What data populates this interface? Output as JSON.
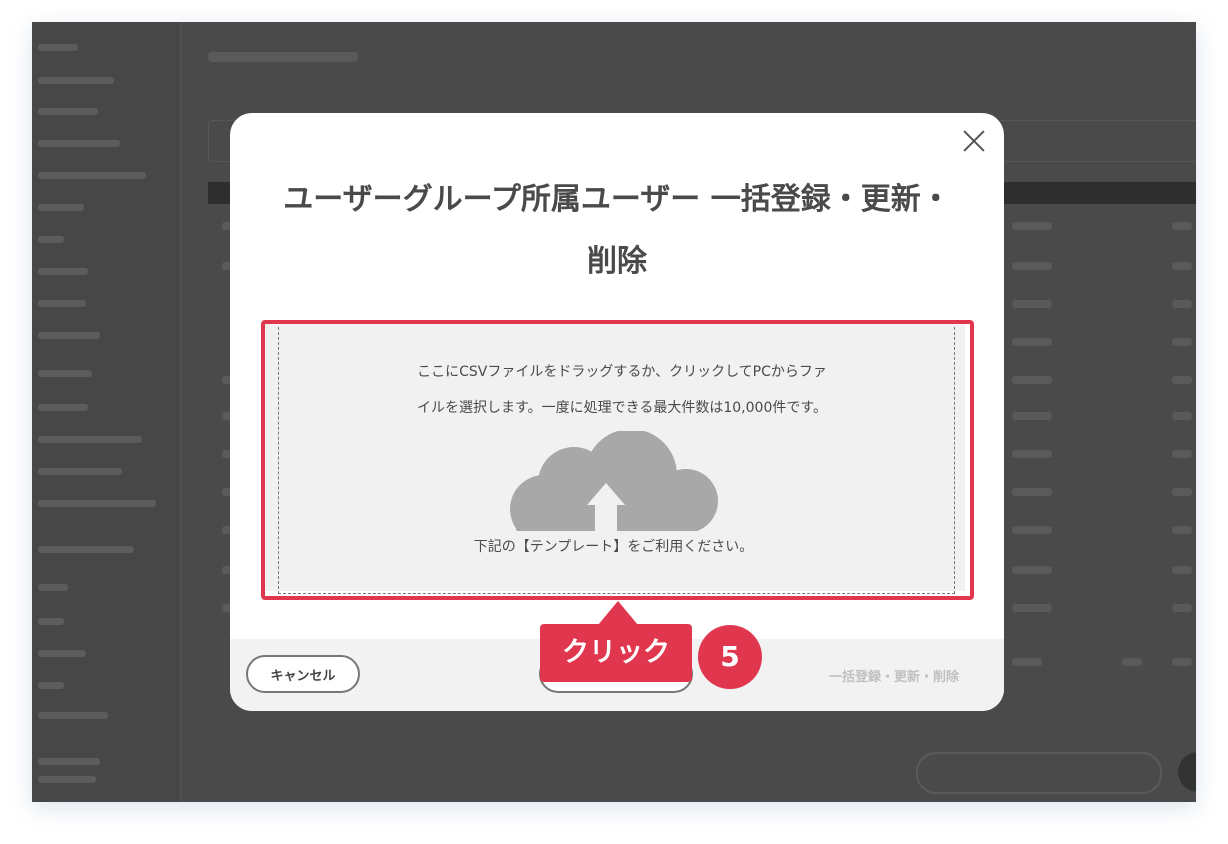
{
  "modal": {
    "title": "ユーザーグループ所属ユーザー 一括登録・更新・削除",
    "dropzone": {
      "instruction_line1": "ここにCSVファイルをドラッグするか、クリックしてPCからファ",
      "instruction_line2": "イルを選択します。一度に処理できる最大件数は10,000件です。",
      "template_note": "下記の【テンプレート】をご利用ください。"
    },
    "footer": {
      "cancel_label": "キャンセル",
      "submit_label": "一括登録・更新・削除"
    }
  },
  "annotation": {
    "callout_label": "クリック",
    "step_number": "5"
  },
  "colors": {
    "accent": "#e0364e",
    "overlay": "#4a4a4a",
    "cloud": "#a8a8a8"
  }
}
